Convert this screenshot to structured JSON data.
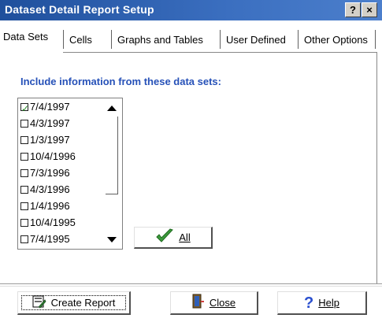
{
  "window": {
    "title": "Dataset Detail Report Setup",
    "help_glyph": "?",
    "close_glyph": "×"
  },
  "tabs": [
    {
      "label": "Data Sets",
      "active": true
    },
    {
      "label": "Cells",
      "active": false
    },
    {
      "label": "Graphs and Tables",
      "active": false
    },
    {
      "label": "User Defined",
      "active": false
    },
    {
      "label": "Other Options",
      "active": false
    }
  ],
  "datasets": {
    "label": "Include information from these data sets:",
    "items": [
      {
        "label": "7/4/1997",
        "checked": true
      },
      {
        "label": "4/3/1997",
        "checked": false
      },
      {
        "label": "1/3/1997",
        "checked": false
      },
      {
        "label": "10/4/1996",
        "checked": false
      },
      {
        "label": "7/3/1996",
        "checked": false
      },
      {
        "label": "4/3/1996",
        "checked": false
      },
      {
        "label": "1/4/1996",
        "checked": false
      },
      {
        "label": "10/4/1995",
        "checked": false
      },
      {
        "label": "7/4/1995",
        "checked": false
      }
    ],
    "all_button": "All"
  },
  "footer": {
    "create_report": "Create Report",
    "close": "Close",
    "help": "Help"
  },
  "colors": {
    "titlebar": "#2a5ca8",
    "section_label": "#2651b8",
    "check": "#2a8a2a",
    "help_icon": "#2a4fcf"
  }
}
